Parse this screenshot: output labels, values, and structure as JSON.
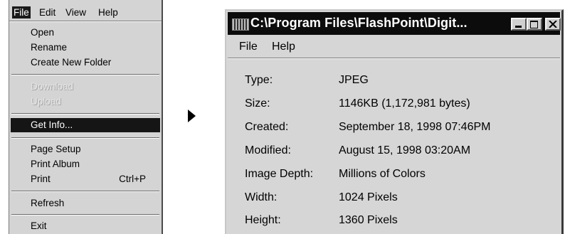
{
  "menu": {
    "bar": [
      "File",
      "Edit",
      "View",
      "Help"
    ],
    "items": {
      "open": "Open",
      "rename": "Rename",
      "create_folder": "Create New Folder",
      "download": "Download",
      "upload": "Upload",
      "get_info": "Get Info...",
      "page_setup": "Page Setup",
      "print_album": "Print Album",
      "print": "Print",
      "print_shortcut": "Ctrl+P",
      "refresh": "Refresh",
      "exit": "Exit"
    }
  },
  "window": {
    "title": "C:\\Program Files\\FlashPoint\\Digit...",
    "menu": [
      "File",
      "Help"
    ],
    "rows": [
      {
        "label": "Type:",
        "value": "JPEG"
      },
      {
        "label": "Size:",
        "value": "1146KB (1,172,981 bytes)"
      },
      {
        "label": "Created:",
        "value": "September 18, 1998  07:46PM"
      },
      {
        "label": "Modified:",
        "value": "August 15, 1998  03:20AM"
      },
      {
        "label": "Image Depth:",
        "value": "Millions of Colors"
      },
      {
        "label": "Width:",
        "value": "1024 Pixels"
      },
      {
        "label": "Height:",
        "value": "1360 Pixels"
      }
    ]
  }
}
